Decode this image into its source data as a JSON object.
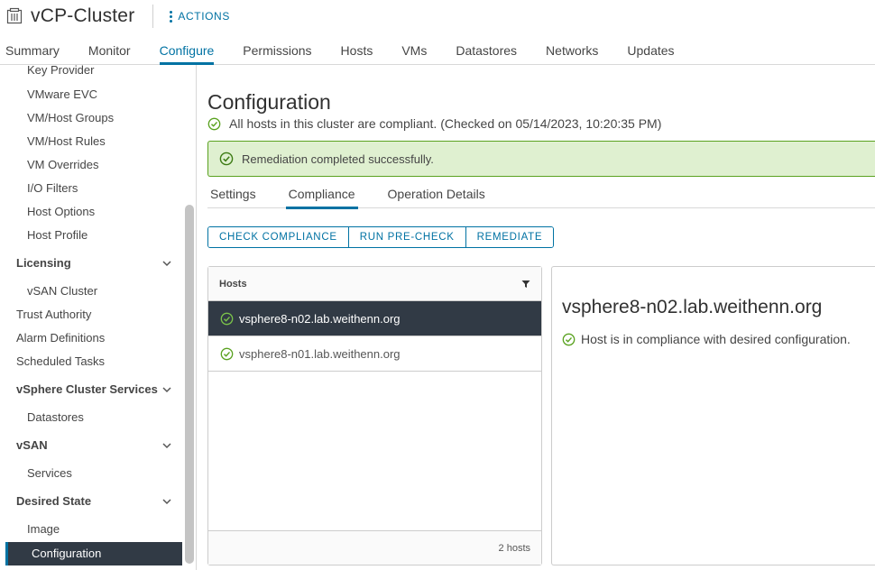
{
  "header": {
    "title": "vCP-Cluster",
    "actions_label": "ACTIONS",
    "tabs": [
      {
        "label": "Summary"
      },
      {
        "label": "Monitor"
      },
      {
        "label": "Configure"
      },
      {
        "label": "Permissions"
      },
      {
        "label": "Hosts"
      },
      {
        "label": "VMs"
      },
      {
        "label": "Datastores"
      },
      {
        "label": "Networks"
      },
      {
        "label": "Updates"
      }
    ],
    "active_tab": "Configure"
  },
  "sidebar": {
    "items": [
      {
        "label": "Key Provider"
      },
      {
        "label": "VMware EVC"
      },
      {
        "label": "VM/Host Groups"
      },
      {
        "label": "VM/Host Rules"
      },
      {
        "label": "VM Overrides"
      },
      {
        "label": "I/O Filters"
      },
      {
        "label": "Host Options"
      },
      {
        "label": "Host Profile"
      },
      {
        "label": "Licensing"
      },
      {
        "label": "vSAN Cluster"
      },
      {
        "label": "Trust Authority"
      },
      {
        "label": "Alarm Definitions"
      },
      {
        "label": "Scheduled Tasks"
      },
      {
        "label": "vSphere Cluster Services"
      },
      {
        "label": "Datastores"
      },
      {
        "label": "vSAN"
      },
      {
        "label": "Services"
      },
      {
        "label": "Desired State"
      },
      {
        "label": "Image"
      },
      {
        "label": "Configuration"
      }
    ],
    "active_item": "Configuration"
  },
  "main": {
    "title": "Configuration",
    "status_text": "All hosts in this cluster are compliant. (Checked on 05/14/2023, 10:20:35 PM)",
    "alert_text": "Remediation completed successfully.",
    "subtabs": [
      {
        "label": "Settings"
      },
      {
        "label": "Compliance"
      },
      {
        "label": "Operation Details"
      }
    ],
    "active_subtab": "Compliance",
    "buttons": {
      "check_compliance": "CHECK COMPLIANCE",
      "run_precheck": "RUN PRE-CHECK",
      "remediate": "REMEDIATE"
    },
    "hosts_panel": {
      "header": "Hosts",
      "rows": [
        {
          "name": "vsphere8-n02.lab.weithenn.org",
          "selected": true
        },
        {
          "name": "vsphere8-n01.lab.weithenn.org",
          "selected": false
        }
      ],
      "footer": "2 hosts"
    },
    "detail_panel": {
      "title": "vsphere8-n02.lab.weithenn.org",
      "status": "Host is in compliance with desired configuration."
    }
  },
  "colors": {
    "accent": "#0072a3",
    "success": "#5aa220",
    "alert_bg": "#dff0d0",
    "selected_bg": "#313a45"
  }
}
